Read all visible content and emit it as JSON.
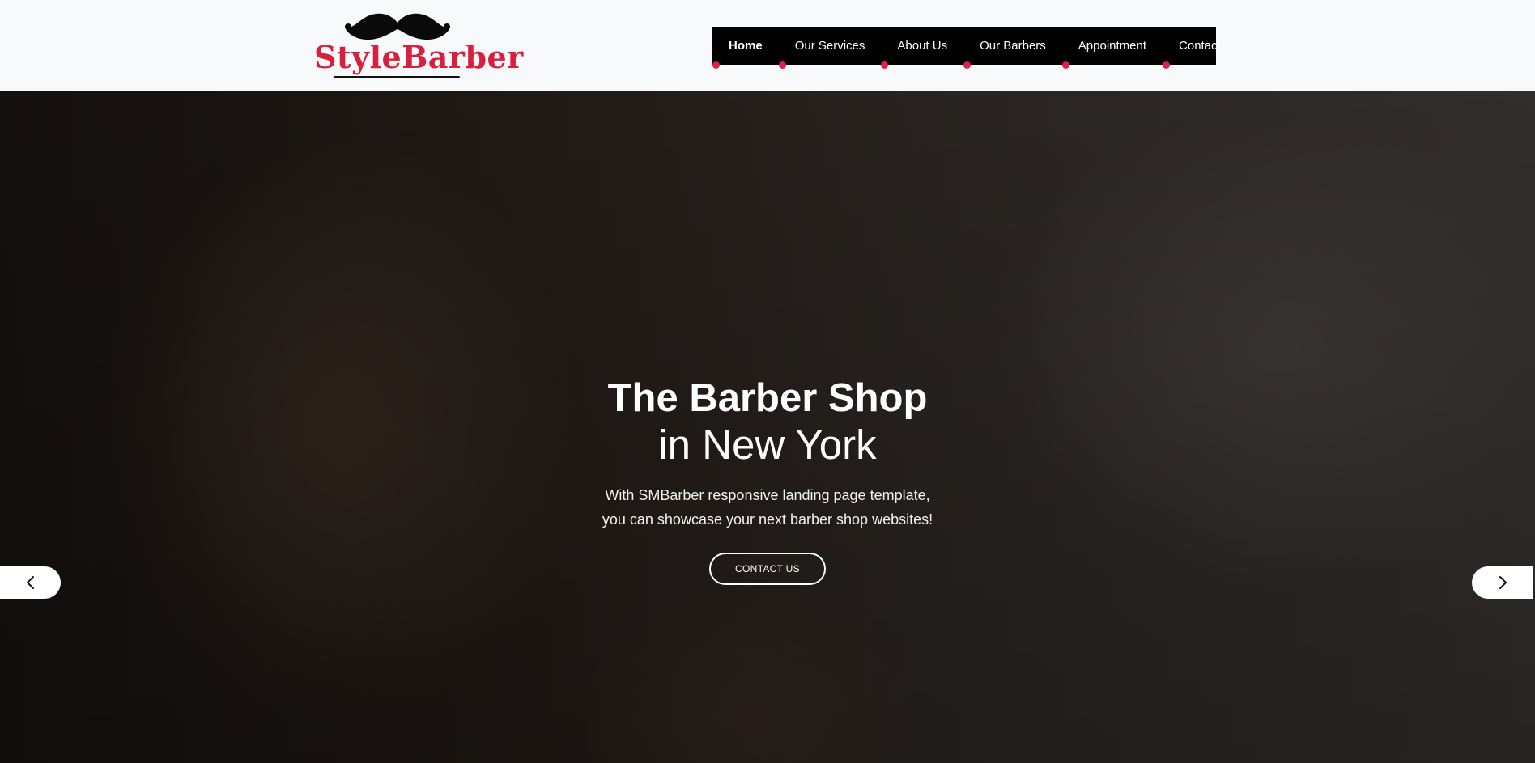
{
  "brand": {
    "logo_text": "StyleBarber",
    "logo_color": "#d81f3d"
  },
  "nav": {
    "items": [
      {
        "label": "Home",
        "active": true
      },
      {
        "label": "Our Services"
      },
      {
        "label": "About Us"
      },
      {
        "label": "Our Barbers"
      },
      {
        "label": "Appointment"
      },
      {
        "label": "Contact"
      }
    ],
    "accent": "#e0224a"
  },
  "hero": {
    "title": "The Barber Shop",
    "subtitle": "in New York",
    "desc_line1": "With SMBarber responsive landing page template,",
    "desc_line2": "you can showcase your next barber shop websites!",
    "cta_label": "CONTACT US",
    "prev_icon": "chevron-left-icon",
    "next_icon": "chevron-right-icon"
  }
}
